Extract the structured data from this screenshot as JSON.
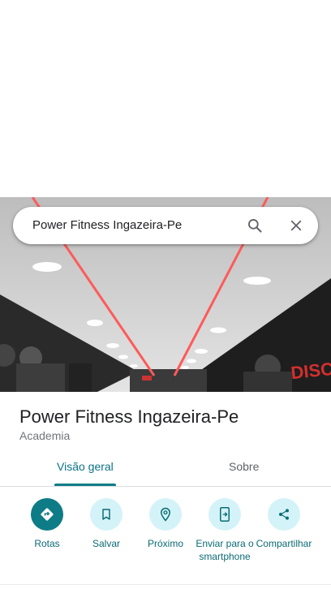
{
  "search": {
    "query": "Power Fitness Ingazeira-Pe"
  },
  "place": {
    "name": "Power Fitness Ingazeira-Pe",
    "category": "Academia"
  },
  "tabs": [
    {
      "label": "Visão geral",
      "active": true
    },
    {
      "label": "Sobre",
      "active": false
    }
  ],
  "actions": [
    {
      "label": "Rotas",
      "icon": "directions-icon"
    },
    {
      "label": "Salvar",
      "icon": "bookmark-icon"
    },
    {
      "label": "Próximo",
      "icon": "nearby-icon"
    },
    {
      "label": "Enviar para o smartphone",
      "icon": "send-to-phone-icon"
    },
    {
      "label": "Compartilhar",
      "icon": "share-icon"
    }
  ],
  "photo_sign": {
    "text": "DISCIPLIN"
  },
  "colors": {
    "accent": "#0e7c86",
    "action_bg": "#d4f3f8",
    "ceiling_led": "#ff5a5a"
  }
}
